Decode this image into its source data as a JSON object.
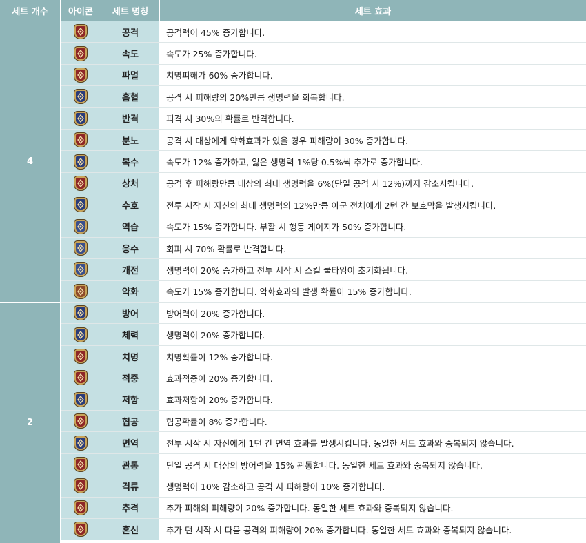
{
  "headers": {
    "set_count": "세트 개수",
    "icon": "아이콘",
    "set_name": "세트 명칭",
    "set_effect": "세트 효과"
  },
  "groups": [
    {
      "count": "4"
    },
    {
      "count": "2"
    }
  ],
  "rows": [
    {
      "name": "공격",
      "desc": "공격력이 45% 증가합니다.",
      "icon": "sword-icon",
      "color": "#8e2626"
    },
    {
      "name": "속도",
      "desc": "속도가 25% 증가합니다.",
      "icon": "speed-arrow-icon",
      "color": "#8e2626"
    },
    {
      "name": "파멸",
      "desc": "치명피해가 60% 증가합니다.",
      "icon": "destruction-icon",
      "color": "#8e2626"
    },
    {
      "name": "흡혈",
      "desc": "공격 시 피해량의 20%만큼 생명력을 회복합니다.",
      "icon": "blood-drop-icon",
      "color": "#2a3c7a"
    },
    {
      "name": "반격",
      "desc": "피격 시 30%의 확률로 반격합니다.",
      "icon": "counter-icon",
      "color": "#2a3c7a"
    },
    {
      "name": "분노",
      "desc": "공격 시 대상에게 약화효과가 있을 경우 피해량이 30% 증가합니다.",
      "icon": "rage-icon",
      "color": "#8e2626"
    },
    {
      "name": "복수",
      "desc": "속도가 12% 증가하고, 잃은 생명력 1%당 0.5%씩 추가로 증가합니다.",
      "icon": "revenge-icon",
      "color": "#2a3c7a"
    },
    {
      "name": "상처",
      "desc": "공격 후 피해량만큼 대상의 최대 생명력을 6%(단일 공격 시 12%)까지 감소시킵니다.",
      "icon": "wound-icon",
      "color": "#8e2626"
    },
    {
      "name": "수호",
      "desc": "전투 시작 시 자신의 최대 생명력의 12%만큼 아군 전체에게 2턴 간 보호막을 발생시킵니다.",
      "icon": "guard-shield-icon",
      "color": "#2a3c7a"
    },
    {
      "name": "역습",
      "desc": "속도가 15% 증가합니다. 부활 시 행동 게이지가 50% 증가합니다.",
      "icon": "wings-icon",
      "color": "#3a4f8c"
    },
    {
      "name": "응수",
      "desc": "회피 시 70% 확률로 반격합니다.",
      "icon": "response-icon",
      "color": "#3a4f8c"
    },
    {
      "name": "개전",
      "desc": "생명력이 20% 증가하고 전투 시작 시 스킬 쿨타임이 초기화됩니다.",
      "icon": "opening-icon",
      "color": "#3a4f8c"
    },
    {
      "name": "약화",
      "desc": "속도가 15% 증가합니다. 약화효과의 발생 확률이 15% 증가합니다.",
      "icon": "weaken-icon",
      "color": "#8e4a2a"
    },
    {
      "name": "방어",
      "desc": "방어력이 20% 증가합니다.",
      "icon": "shield-icon",
      "color": "#2a3c7a"
    },
    {
      "name": "체력",
      "desc": "생명력이 20% 증가합니다.",
      "icon": "heart-icon",
      "color": "#2a3c7a"
    },
    {
      "name": "치명",
      "desc": "치명확률이 12% 증가합니다.",
      "icon": "critical-icon",
      "color": "#8e2626"
    },
    {
      "name": "적중",
      "desc": "효과적중이 20% 증가합니다.",
      "icon": "target-icon",
      "color": "#8e2626"
    },
    {
      "name": "저항",
      "desc": "효과저항이 20% 증가합니다.",
      "icon": "resist-icon",
      "color": "#2a3c7a"
    },
    {
      "name": "협공",
      "desc": "협공확률이 8% 증가합니다.",
      "icon": "cooperation-icon",
      "color": "#8e2626"
    },
    {
      "name": "면역",
      "desc": "전투 시작 시 자신에게 1턴 간 면역 효과를 발생시킵니다. 동일한 세트 효과와 중복되지 않습니다.",
      "icon": "immunity-icon",
      "color": "#2a3c7a"
    },
    {
      "name": "관통",
      "desc": "단일 공격 시 대상의 방어력을 15% 관통합니다. 동일한 세트 효과와 중복되지 않습니다.",
      "icon": "pierce-icon",
      "color": "#8e2626"
    },
    {
      "name": "격류",
      "desc": "생명력이 10% 감소하고 공격 시 피해량이 10% 증가합니다.",
      "icon": "torrent-icon",
      "color": "#8e2626"
    },
    {
      "name": "추격",
      "desc": "추가 피해의 피해량이 20% 증가합니다. 동일한 세트 효과와 중복되지 않습니다.",
      "icon": "pursuit-icon",
      "color": "#8e2626"
    },
    {
      "name": "혼신",
      "desc": "추가 턴 시작 시 다음 공격의 피해량이 20% 증가합니다. 동일한 세트 효과와 중복되지 않습니다.",
      "icon": "devotion-icon",
      "color": "#8e2626"
    }
  ]
}
